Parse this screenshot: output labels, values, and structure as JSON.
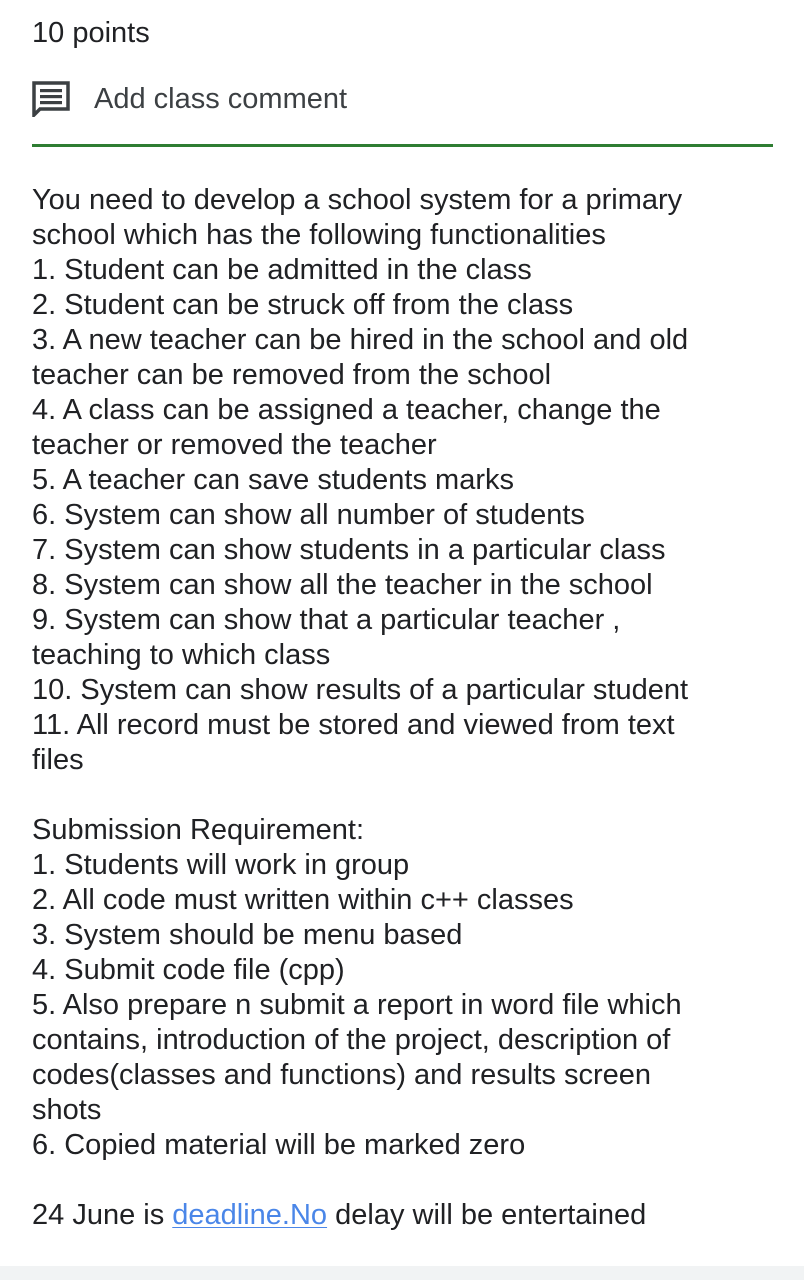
{
  "assignment": {
    "points": "10 points",
    "comment_label": "Add class comment",
    "divider_color": "#2e7d32",
    "comment_icon": "comment-icon"
  },
  "description": {
    "lines": [
      "You need to develop a school system for a primary",
      "school which has the following functionalities",
      "1. Student can be admitted in the class",
      "2. Student can be struck off from the class",
      "3. A new teacher can be hired in the school and old",
      "teacher can be removed from the school",
      "4. A class can be assigned a teacher, change the",
      "teacher or removed the teacher",
      "5. A teacher can save students marks",
      "6. System can show all number of students",
      "7. System can show students in a particular class",
      "8. System can show all the teacher in the school",
      "9. System can show that a particular teacher ,",
      "teaching to which class",
      "10. System can show results of a particular student",
      "11. All record must be stored and viewed from text",
      "files",
      "",
      "Submission Requirement:",
      "1. Students will work in group",
      "2. All code must written within c++ classes",
      "3. System should be menu based",
      "4. Submit code file (cpp)",
      "5. Also prepare n submit a report in word file which",
      "contains, introduction of the project, description of",
      "codes(classes and functions) and results screen",
      "shots",
      "6. Copied material will be marked zero"
    ],
    "deadline_before": "24 June is ",
    "deadline_link": "deadline.No",
    "deadline_after": " delay will be entertained",
    "link_color": "#4a86e8"
  }
}
